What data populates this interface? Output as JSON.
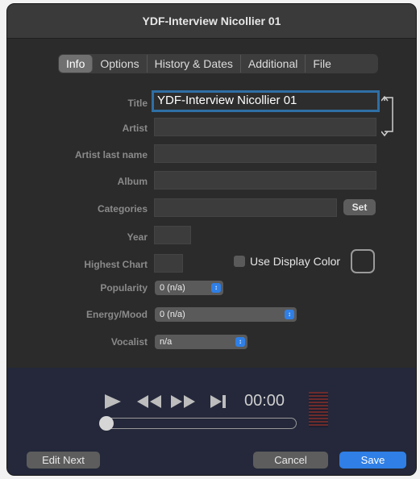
{
  "window": {
    "title": "YDF-Interview Nicollier 01"
  },
  "tabs": [
    "Info",
    "Options",
    "History & Dates",
    "Additional",
    "File"
  ],
  "fields": {
    "title": {
      "label": "Title",
      "value": "YDF-Interview Nicollier 01"
    },
    "artist": {
      "label": "Artist",
      "value": ""
    },
    "artist_last_name": {
      "label": "Artist last name",
      "value": ""
    },
    "album": {
      "label": "Album",
      "value": ""
    },
    "categories": {
      "label": "Categories",
      "value": "",
      "button": "Set"
    },
    "year": {
      "label": "Year",
      "value": ""
    },
    "highest_chart": {
      "label": "Highest Chart",
      "value": ""
    },
    "popularity": {
      "label": "Popularity",
      "value": "0 (n/a)"
    },
    "energy_mood": {
      "label": "Energy/Mood",
      "value": "0 (n/a)"
    },
    "vocalist": {
      "label": "Vocalist",
      "value": "n/a"
    }
  },
  "use_display_color": {
    "label": "Use Display Color",
    "checked": false
  },
  "player": {
    "time": "00:00",
    "progress": 0
  },
  "buttons": {
    "edit_next": "Edit Next",
    "cancel": "Cancel",
    "save": "Save"
  },
  "icons": {
    "play": "play-icon",
    "rewind": "rewind-icon",
    "fast_forward": "fast-forward-icon",
    "skip_end": "skip-to-end-icon",
    "link": "link-bracket-icon"
  },
  "colors": {
    "accent": "#2f7fe6",
    "focus_ring": "#2f6fa5"
  }
}
